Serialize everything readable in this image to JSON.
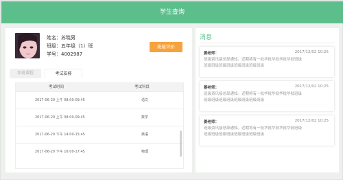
{
  "header": {
    "title": "学生查询"
  },
  "student": {
    "name_line": "姓名：苏晓男",
    "class_line": "班级：五年级（1）班",
    "id_line": "学号：4002987",
    "evaluate_button": "班级评价"
  },
  "tabs": [
    {
      "label": "本班课程",
      "active": false
    },
    {
      "label": "考试安排",
      "active": true
    }
  ],
  "exam_table": {
    "headers": [
      "考试时间",
      "考试科目"
    ],
    "rows": [
      {
        "time": "2017-06-20 上午 08:00-09:45",
        "subject": "语文"
      },
      {
        "time": "2017-06-20 上午 08:00-09:45",
        "subject": "数学"
      },
      {
        "time": "2017-06-20 下午 14:00-15:45",
        "subject": "英语"
      },
      {
        "time": "2017-06-20 下午 16:00-17:45",
        "subject": "物理"
      }
    ]
  },
  "messages": {
    "title": "消息",
    "items": [
      {
        "teacher": "姜老师：",
        "time": "2017/12/02 10:25",
        "line1": "班级资讯接总部通知。近期将有一批华批华批华批华批班级",
        "line2": "班级班级班级班级班级班级班级班级"
      },
      {
        "teacher": "姜老师：",
        "time": "2017/12/02 10:25",
        "line1": "班级资讯接总部通知。近期将有一批华批华批华批华批班级",
        "line2": "班级班级班级班级班级班级班级班级"
      },
      {
        "teacher": "姜老师：",
        "time": "2017/12/02 10:25",
        "line1": "班级资讯接总部通知。近期将有一批华批华批华批华批班级",
        "line2": "班级班级班级班级班级班级班级班级"
      }
    ]
  },
  "colors": {
    "header_bg": "#5cbf8b",
    "accent_green": "#4fbd84",
    "button_orange": "#f6a23e"
  }
}
